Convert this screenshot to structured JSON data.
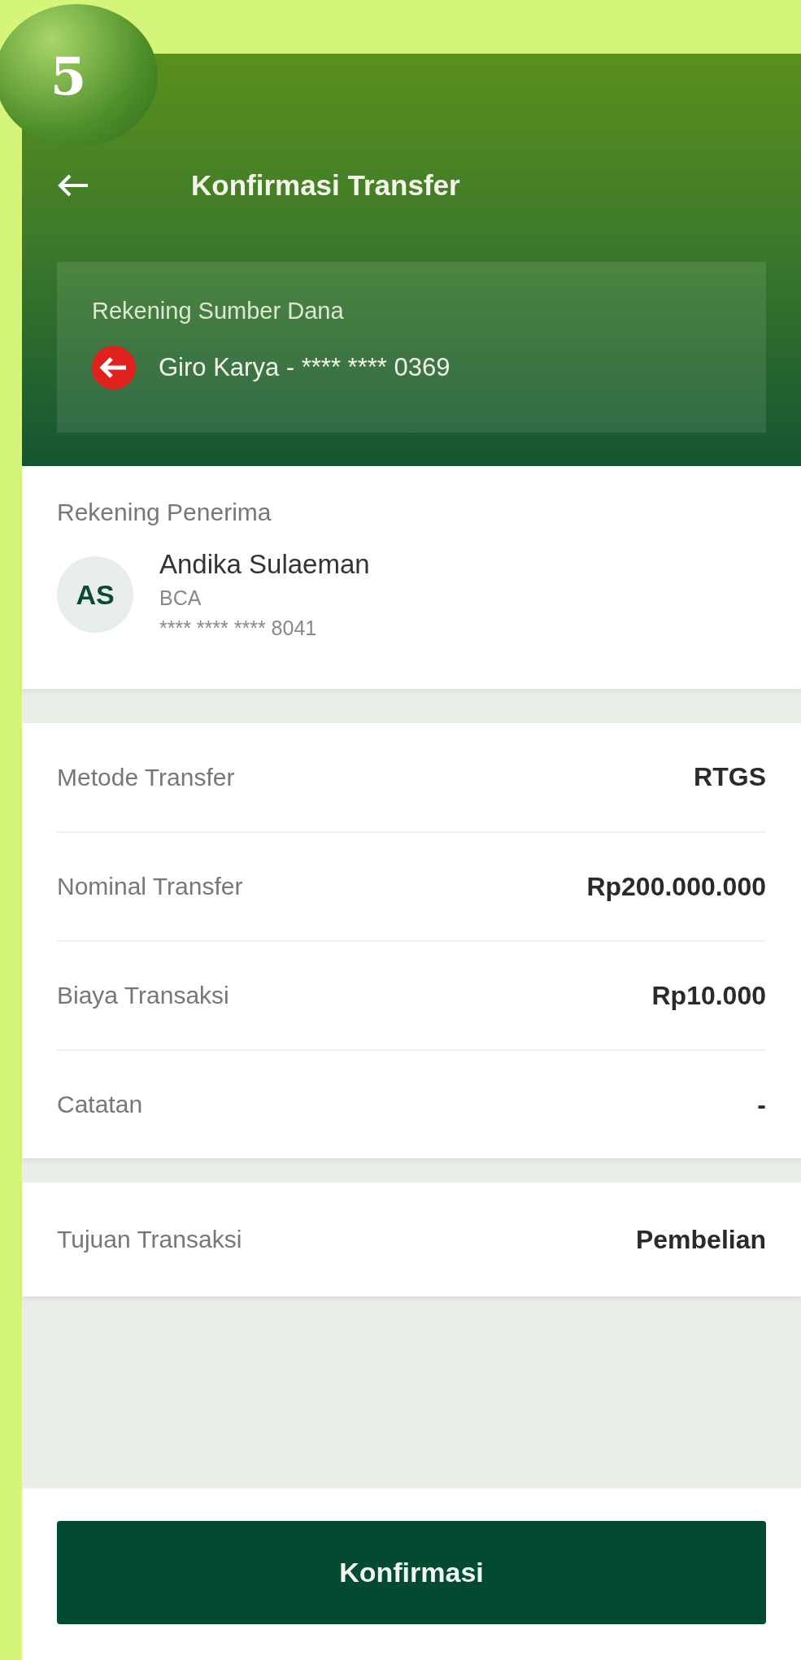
{
  "step_badge": "5",
  "header": {
    "title": "Konfirmasi Transfer"
  },
  "source_account": {
    "label": "Rekening Sumber Dana",
    "account": "Giro Karya - **** **** 0369"
  },
  "recipient": {
    "section_label": "Rekening Penerima",
    "initials": "AS",
    "name": "Andika Sulaeman",
    "bank": "BCA",
    "account_number": "**** **** **** 8041"
  },
  "details": [
    {
      "label": "Metode Transfer",
      "value": "RTGS"
    },
    {
      "label": "Nominal Transfer",
      "value": "Rp200.000.000"
    },
    {
      "label": "Biaya Transaksi",
      "value": "Rp10.000"
    },
    {
      "label": "Catatan",
      "value": "-"
    }
  ],
  "purpose": [
    {
      "label": "Tujuan Transaksi",
      "value": "Pembelian"
    }
  ],
  "confirm_button": "Konfirmasi"
}
